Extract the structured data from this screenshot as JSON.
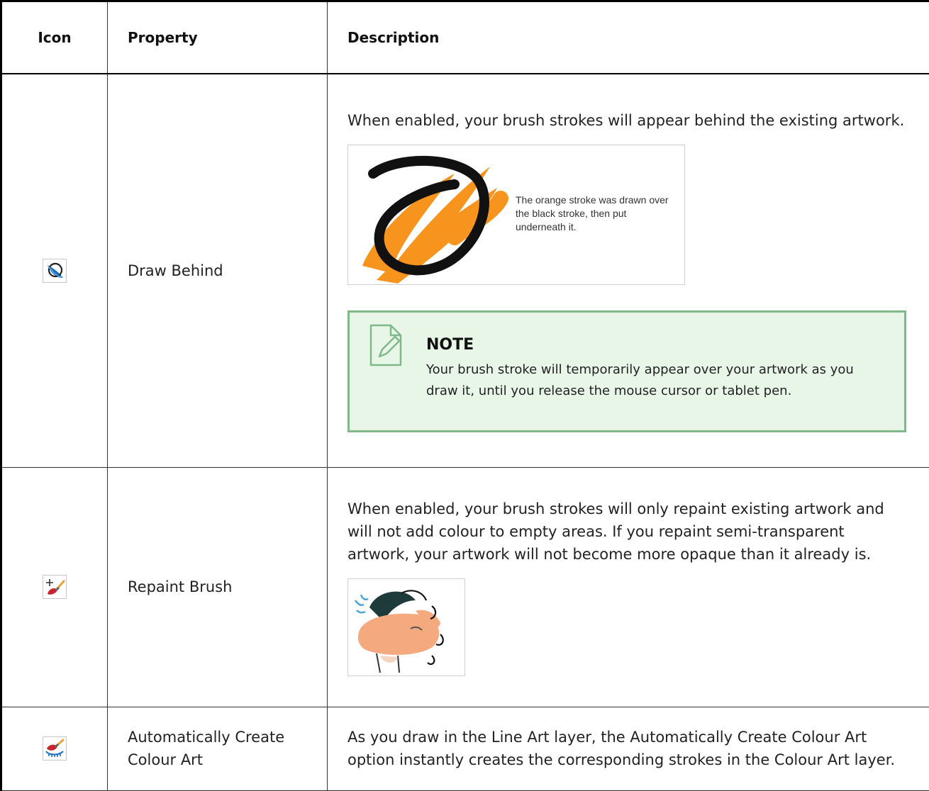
{
  "table": {
    "headers": {
      "icon": "Icon",
      "property": "Property",
      "description": "Description"
    },
    "rows": [
      {
        "icon": "draw-behind-icon",
        "property": "Draw Behind",
        "description": "When enabled, your brush strokes will appear behind the existing artwork.",
        "figure_caption": "The orange stroke was drawn over the black stroke, then put underneath it.",
        "note": {
          "icon": "note-icon",
          "title": "NOTE",
          "text": "Your brush stroke will temporarily appear over your artwork as you draw it, until you release the mouse cursor or tablet pen."
        }
      },
      {
        "icon": "repaint-brush-icon",
        "property": "Repaint Brush",
        "description": "When enabled, your brush strokes will only repaint existing artwork and will not add colour to empty areas. If you repaint semi-transparent artwork, your artwork will not become more opaque than it already is."
      },
      {
        "icon": "auto-colour-art-icon",
        "property": "Automatically Create Colour Art",
        "description": "As you draw in the Line Art layer, the Automatically Create Colour Art option instantly creates the corresponding strokes in the Colour Art layer."
      }
    ]
  },
  "colors": {
    "note_bg": "#e8f6e8",
    "note_border": "#7fb98a",
    "stroke_orange": "#f7941d"
  }
}
